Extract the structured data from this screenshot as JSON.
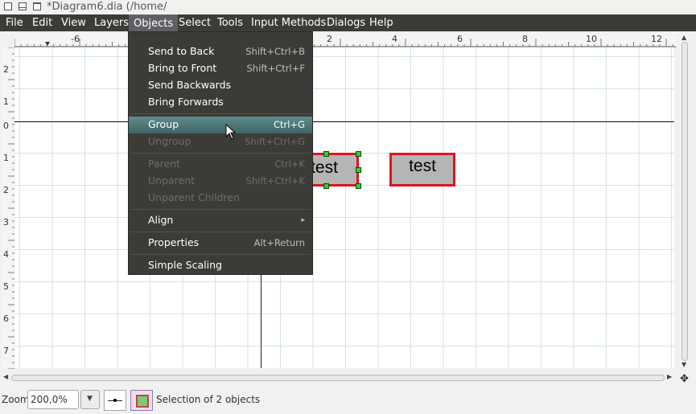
{
  "window": {
    "title": "*Diagram6.dia (/home/"
  },
  "menubar": {
    "items": [
      "File",
      "Edit",
      "View",
      "Layers",
      "Objects",
      "Select",
      "Tools",
      "Input Methods",
      "Dialogs",
      "Help"
    ]
  },
  "objects_menu": {
    "items": [
      {
        "label": "Send to Back",
        "shortcut": "Shift+Ctrl+B",
        "enabled": true
      },
      {
        "label": "Bring to Front",
        "shortcut": "Shift+Ctrl+F",
        "enabled": true
      },
      {
        "label": "Send Backwards",
        "shortcut": "",
        "enabled": true
      },
      {
        "label": "Bring Forwards",
        "shortcut": "",
        "enabled": true
      },
      {
        "label": "Group",
        "shortcut": "Ctrl+G",
        "enabled": true,
        "highlighted": true
      },
      {
        "label": "Ungroup",
        "shortcut": "Shift+Ctrl+G",
        "enabled": false
      },
      {
        "label": "Parent",
        "shortcut": "Ctrl+K",
        "enabled": false
      },
      {
        "label": "Unparent",
        "shortcut": "Shift+Ctrl+K",
        "enabled": false
      },
      {
        "label": "Unparent Children",
        "shortcut": "",
        "enabled": false
      },
      {
        "label": "Align",
        "shortcut": "",
        "enabled": true,
        "submenu": true
      },
      {
        "label": "Properties",
        "shortcut": "Alt+Return",
        "enabled": true
      },
      {
        "label": "Simple Scaling",
        "shortcut": "",
        "enabled": true
      }
    ]
  },
  "hruler": {
    "labels": [
      "-6",
      "2",
      "4",
      "6",
      "8",
      "10",
      "12"
    ]
  },
  "vruler": {
    "labels": [
      "2",
      "1",
      "0",
      "1",
      "2",
      "3",
      "4",
      "5",
      "6",
      "7"
    ]
  },
  "diagram": {
    "box1_text": "test",
    "box2_text": "test"
  },
  "status": {
    "zoom_label": "Zoom",
    "zoom_value": "200,0%",
    "selection_text": "Selection of 2 objects"
  },
  "colors": {
    "menubar_bg": "#3c3b37",
    "highlight": "#4f7373",
    "box_border": "#e0141e",
    "box_fill": "#b5b5b5"
  }
}
